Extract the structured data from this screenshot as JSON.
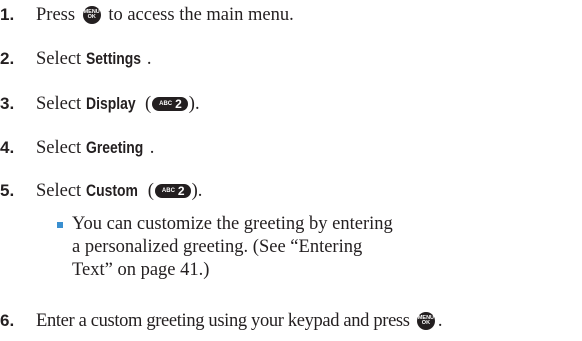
{
  "steps": [
    {
      "num": "1.",
      "before": "Press ",
      "key": "menu",
      "after": " to access the main menu."
    },
    {
      "num": "2.",
      "before": "Select ",
      "bold": "Settings",
      "after": "."
    },
    {
      "num": "3.",
      "before": "Select ",
      "bold": "Display",
      "paren_open": " (",
      "key": "abc2",
      "paren_close": ")."
    },
    {
      "num": "4.",
      "before": "Select ",
      "bold": "Greeting",
      "after": "."
    },
    {
      "num": "5.",
      "before": "Select ",
      "bold": "Custom",
      "paren_open": " (",
      "key": "abc2",
      "paren_close": ")."
    },
    {
      "num": "6.",
      "before": "Enter a custom greeting using your keypad and press ",
      "key": "menu",
      "after": "."
    }
  ],
  "keys": {
    "menu_top": "MENU",
    "menu_bottom": "OK",
    "abc_small": "ABC",
    "abc_big": "2"
  },
  "bullet_note": "You can customize the greeting by entering a personalized greeting. (See “Entering Text” on page 41.)",
  "colors": {
    "text": "#231f20",
    "bullet": "#3a8fd0"
  }
}
